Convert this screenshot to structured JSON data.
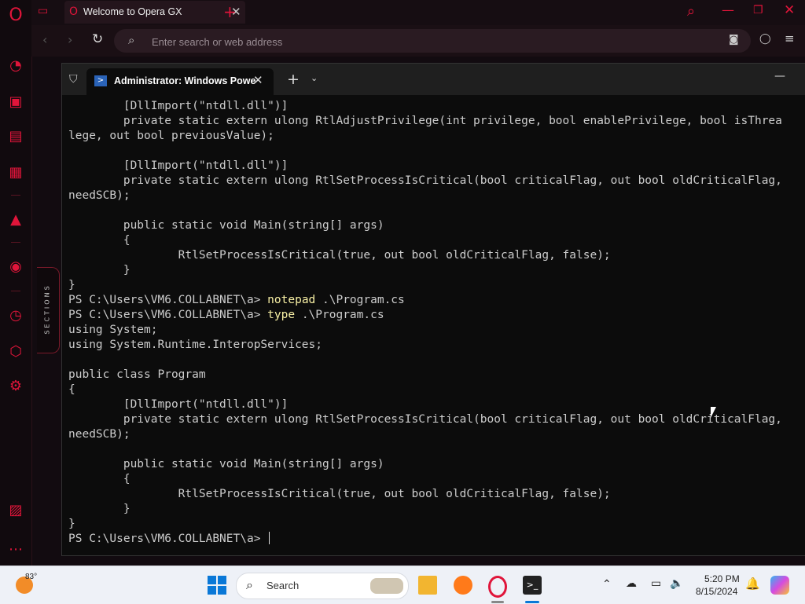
{
  "browser": {
    "tab_title": "Welcome to Opera GX",
    "address_placeholder": "Enter search or web address",
    "sidebar_label": "SECTIONS"
  },
  "terminal": {
    "tab_title": "Administrator: Windows Powe",
    "lines": [
      {
        "text": "        [DllImport(\"ntdll.dll\")]"
      },
      {
        "text": "        private static extern ulong RtlAdjustPrivilege(int privilege, bool enablePrivilege, bool isThrea"
      },
      {
        "text": "lege, out bool previousValue);"
      },
      {
        "text": ""
      },
      {
        "text": "        [DllImport(\"ntdll.dll\")]"
      },
      {
        "text": "        private static extern ulong RtlSetProcessIsCritical(bool criticalFlag, out bool oldCriticalFlag,"
      },
      {
        "text": "needSCB);"
      },
      {
        "text": ""
      },
      {
        "text": "        public static void Main(string[] args)"
      },
      {
        "text": "        {"
      },
      {
        "text": "                RtlSetProcessIsCritical(true, out bool oldCriticalFlag, false);"
      },
      {
        "text": "        }"
      },
      {
        "text": "}"
      },
      {
        "prompt": "PS C:\\Users\\VM6.COLLABNET\\a> ",
        "cmd": "notepad",
        "args": " .\\Program.cs"
      },
      {
        "prompt": "PS C:\\Users\\VM6.COLLABNET\\a> ",
        "cmd": "type",
        "args": " .\\Program.cs"
      },
      {
        "text": "using System;"
      },
      {
        "text": "using System.Runtime.InteropServices;"
      },
      {
        "text": ""
      },
      {
        "text": "public class Program"
      },
      {
        "text": "{"
      },
      {
        "text": "        [DllImport(\"ntdll.dll\")]"
      },
      {
        "text": "        private static extern ulong RtlSetProcessIsCritical(bool criticalFlag, out bool oldCriticalFlag,"
      },
      {
        "text": "needSCB);"
      },
      {
        "text": ""
      },
      {
        "text": "        public static void Main(string[] args)"
      },
      {
        "text": "        {"
      },
      {
        "text": "                RtlSetProcessIsCritical(true, out bool oldCriticalFlag, false);"
      },
      {
        "text": "        }"
      },
      {
        "text": "}"
      },
      {
        "prompt": "PS C:\\Users\\VM6.COLLABNET\\a> ",
        "cursor": true
      }
    ]
  },
  "taskbar": {
    "weather_temp": "83°",
    "search_label": "Search",
    "time": "5:20 PM",
    "date": "8/15/2024"
  }
}
